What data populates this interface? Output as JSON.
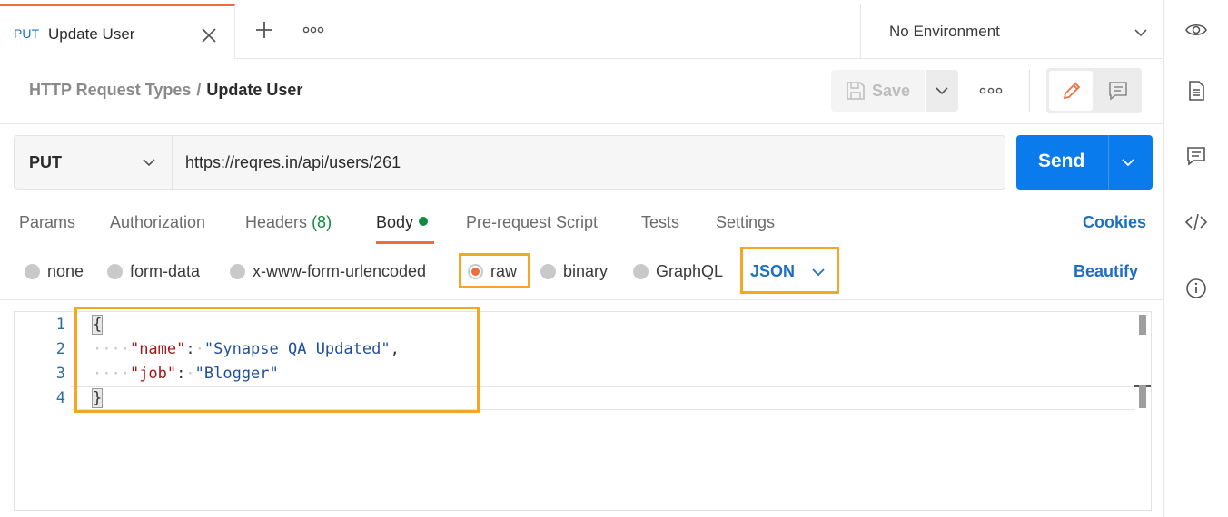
{
  "tabbar": {
    "active_tab": {
      "method": "PUT",
      "name": "Update User"
    },
    "environment": "No Environment"
  },
  "breadcrumb": {
    "parent": "HTTP Request Types",
    "separator": "/",
    "current": "Update User"
  },
  "toolbar": {
    "save_label": "Save"
  },
  "request": {
    "method": "PUT",
    "url": "https://reqres.in/api/users/261",
    "send_label": "Send"
  },
  "request_tabs": {
    "params": "Params",
    "authorization": "Authorization",
    "headers": "Headers",
    "headers_count": "(8)",
    "body": "Body",
    "pre_request": "Pre-request Script",
    "tests": "Tests",
    "settings": "Settings",
    "cookies": "Cookies"
  },
  "body_types": {
    "none": "none",
    "form_data": "form-data",
    "urlencoded": "x-www-form-urlencoded",
    "raw": "raw",
    "binary": "binary",
    "graphql": "GraphQL",
    "selected": "raw",
    "format": "JSON",
    "beautify": "Beautify"
  },
  "editor": {
    "line_numbers": [
      "1",
      "2",
      "3",
      "4"
    ],
    "open_brace": "{",
    "close_brace": "}",
    "line2": {
      "key": "\"name\"",
      "colon": ":",
      "value": "\"Synapse QA Updated\"",
      "comma": ","
    },
    "line3": {
      "key": "\"job\"",
      "colon": ":",
      "value": "\"Blogger\""
    }
  },
  "colors": {
    "accent": "#f26b3a",
    "primary": "#097bed",
    "link": "#1c6fc2",
    "highlight_box": "#f5a623",
    "success": "#0f8a3f"
  },
  "icons": {
    "tab_close": "close-icon",
    "new_tab": "plus-icon",
    "more": "more-icon",
    "environment_dropdown": "chevron-down-icon",
    "eye": "eye-icon",
    "save": "save-icon",
    "edit": "pencil-icon",
    "comments": "comment-icon",
    "documentation": "document-icon",
    "code": "code-icon",
    "info": "info-icon"
  }
}
